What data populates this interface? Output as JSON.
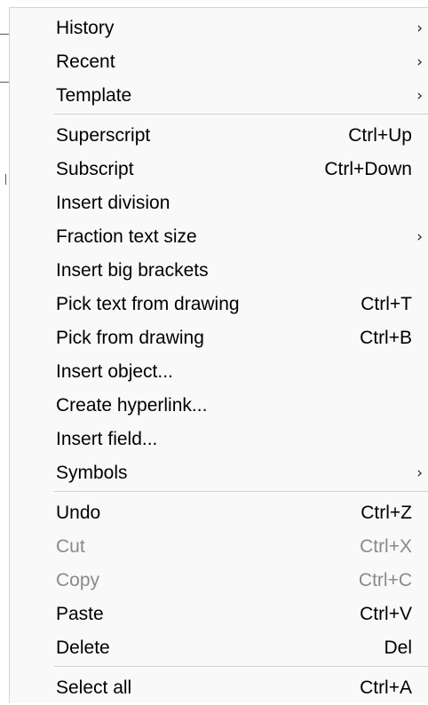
{
  "menu": {
    "groups": [
      [
        {
          "label": "History",
          "submenu": true
        },
        {
          "label": "Recent",
          "submenu": true
        },
        {
          "label": "Template",
          "submenu": true
        }
      ],
      [
        {
          "label": "Superscript",
          "shortcut": "Ctrl+Up"
        },
        {
          "label": "Subscript",
          "shortcut": "Ctrl+Down"
        },
        {
          "label": "Insert division"
        },
        {
          "label": "Fraction text size",
          "submenu": true
        },
        {
          "label": "Insert big brackets"
        },
        {
          "label": "Pick text from drawing",
          "shortcut": "Ctrl+T"
        },
        {
          "label": "Pick from drawing",
          "shortcut": "Ctrl+B"
        },
        {
          "label": "Insert object..."
        },
        {
          "label": "Create hyperlink..."
        },
        {
          "label": "Insert field..."
        },
        {
          "label": "Symbols",
          "submenu": true
        }
      ],
      [
        {
          "label": "Undo",
          "shortcut": "Ctrl+Z"
        },
        {
          "label": "Cut",
          "shortcut": "Ctrl+X",
          "disabled": true
        },
        {
          "label": "Copy",
          "shortcut": "Ctrl+C",
          "disabled": true
        },
        {
          "label": "Paste",
          "shortcut": "Ctrl+V"
        },
        {
          "label": "Delete",
          "shortcut": "Del"
        }
      ],
      [
        {
          "label": "Select all",
          "shortcut": "Ctrl+A"
        }
      ]
    ],
    "chevron_glyph": "›",
    "colors": {
      "background": "#f9f9f9",
      "text": "#000000",
      "disabled_text": "#8a8a8a",
      "separator": "#d0d0d0"
    }
  }
}
